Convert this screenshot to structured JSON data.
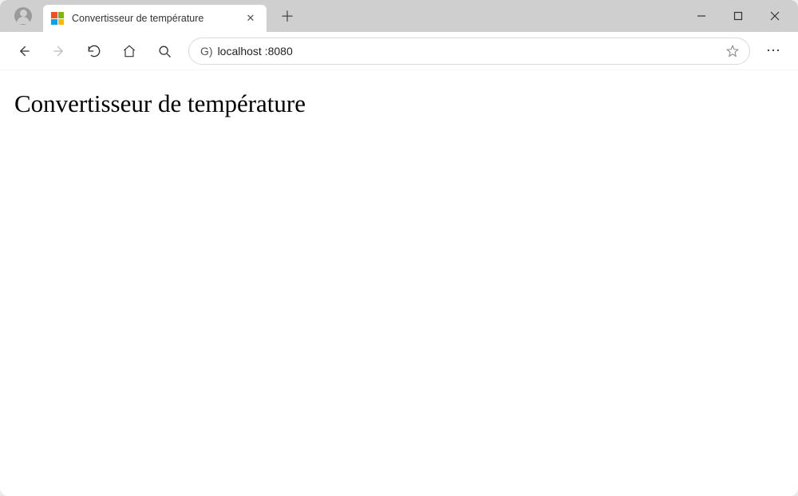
{
  "tab": {
    "title": "Convertisseur de température"
  },
  "addressbar": {
    "prefix": "G)",
    "url": "localhost :8080"
  },
  "page": {
    "heading": "Convertisseur de température"
  }
}
